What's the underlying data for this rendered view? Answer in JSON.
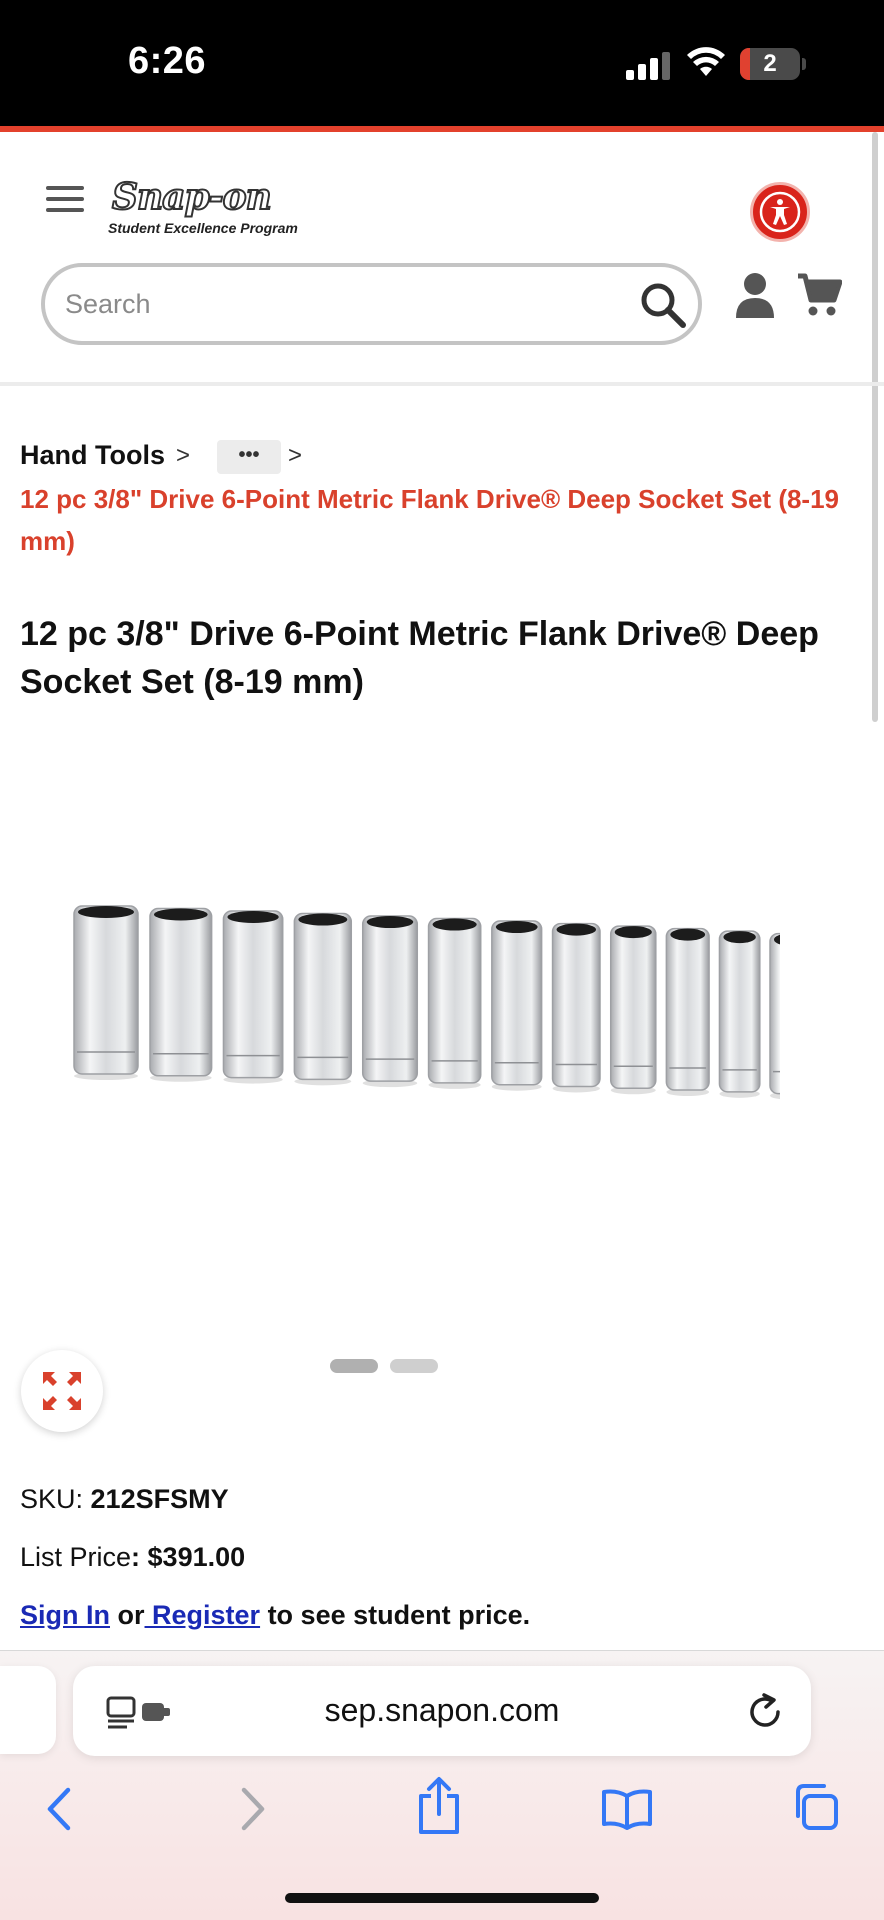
{
  "status_bar": {
    "time": "6:26",
    "battery": "2"
  },
  "header": {
    "logo_text": "Snap-on",
    "logo_subtitle": "Student Excellence Program",
    "search_placeholder": "Search"
  },
  "breadcrumb": {
    "home": "Hand Tools",
    "separator": ">",
    "more": "•••",
    "current": "12 pc 3/8\" Drive 6-Point Metric Flank Drive® Deep Socket Set (8-19 mm)"
  },
  "product": {
    "title": "12 pc 3/8\" Drive 6-Point Metric Flank Drive® Deep Socket Set (8-19 mm)",
    "sku_label": "SKU: ",
    "sku": "212SFSMY",
    "price_label": "List Price",
    "price": ": $391.00",
    "sign_in": "Sign In",
    "or": " or",
    "register": " Register",
    "price_note": " to see student price.",
    "image_count": 2,
    "active_image": 1
  },
  "browser": {
    "url": "sep.snapon.com"
  },
  "colors": {
    "brand_red": "#d9412c",
    "link_blue": "#1a2ab5",
    "accessibility_red": "#d9241b",
    "ios_blue": "#3478f6"
  }
}
